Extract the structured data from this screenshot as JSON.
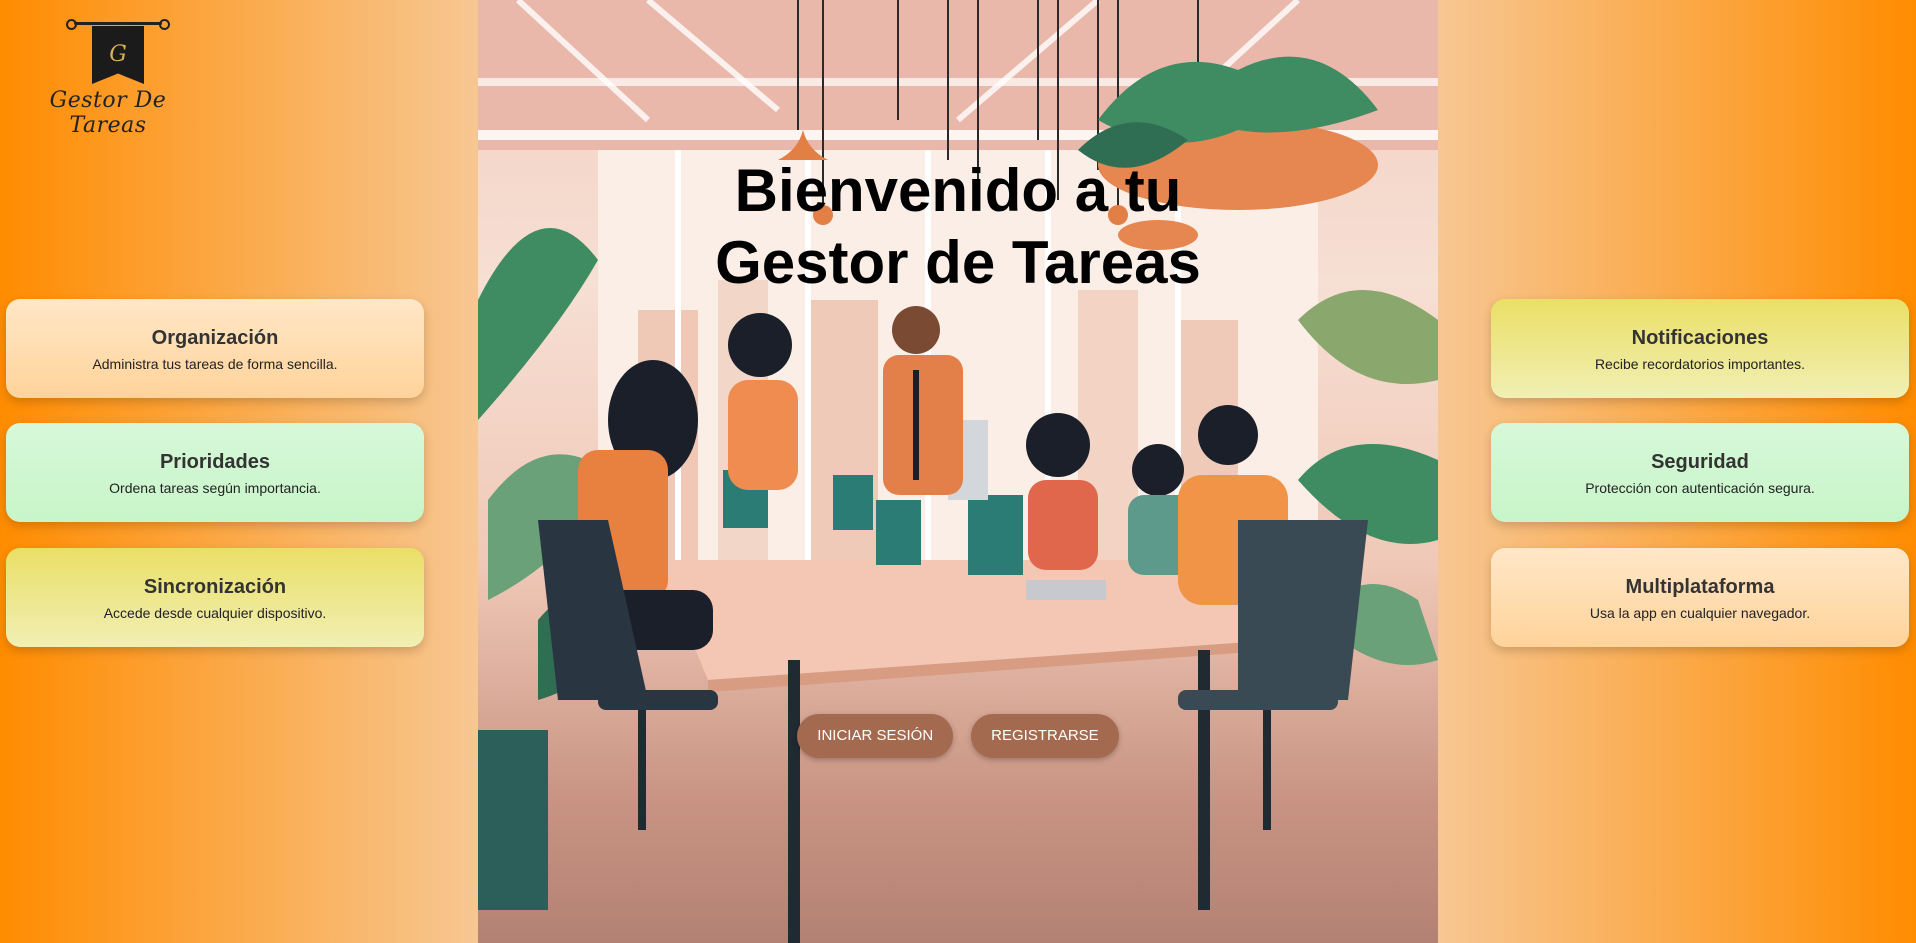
{
  "logo": {
    "monogram": "G",
    "text": "Gestor De Tareas"
  },
  "hero": {
    "title_line1": "Bienvenido a tu",
    "title_line2": "Gestor de Tareas",
    "login_label": "INICIAR SESIÓN",
    "register_label": "REGISTRARSE"
  },
  "features_left": [
    {
      "title": "Organización",
      "desc": "Administra tus tareas de forma sencilla."
    },
    {
      "title": "Prioridades",
      "desc": "Ordena tareas según importancia."
    },
    {
      "title": "Sincronización",
      "desc": "Accede desde cualquier dispositivo."
    }
  ],
  "features_right": [
    {
      "title": "Notificaciones",
      "desc": "Recibe recordatorios importantes."
    },
    {
      "title": "Seguridad",
      "desc": "Protección con autenticación segura."
    },
    {
      "title": "Multiplataforma",
      "desc": "Usa la app en cualquier navegador."
    }
  ],
  "colors": {
    "page_edge": "#ff8c00",
    "button": "#a36a4f",
    "card_orange": "#ffd39a",
    "card_green": "#c8f5c9",
    "card_yellow": "#eadf66"
  }
}
